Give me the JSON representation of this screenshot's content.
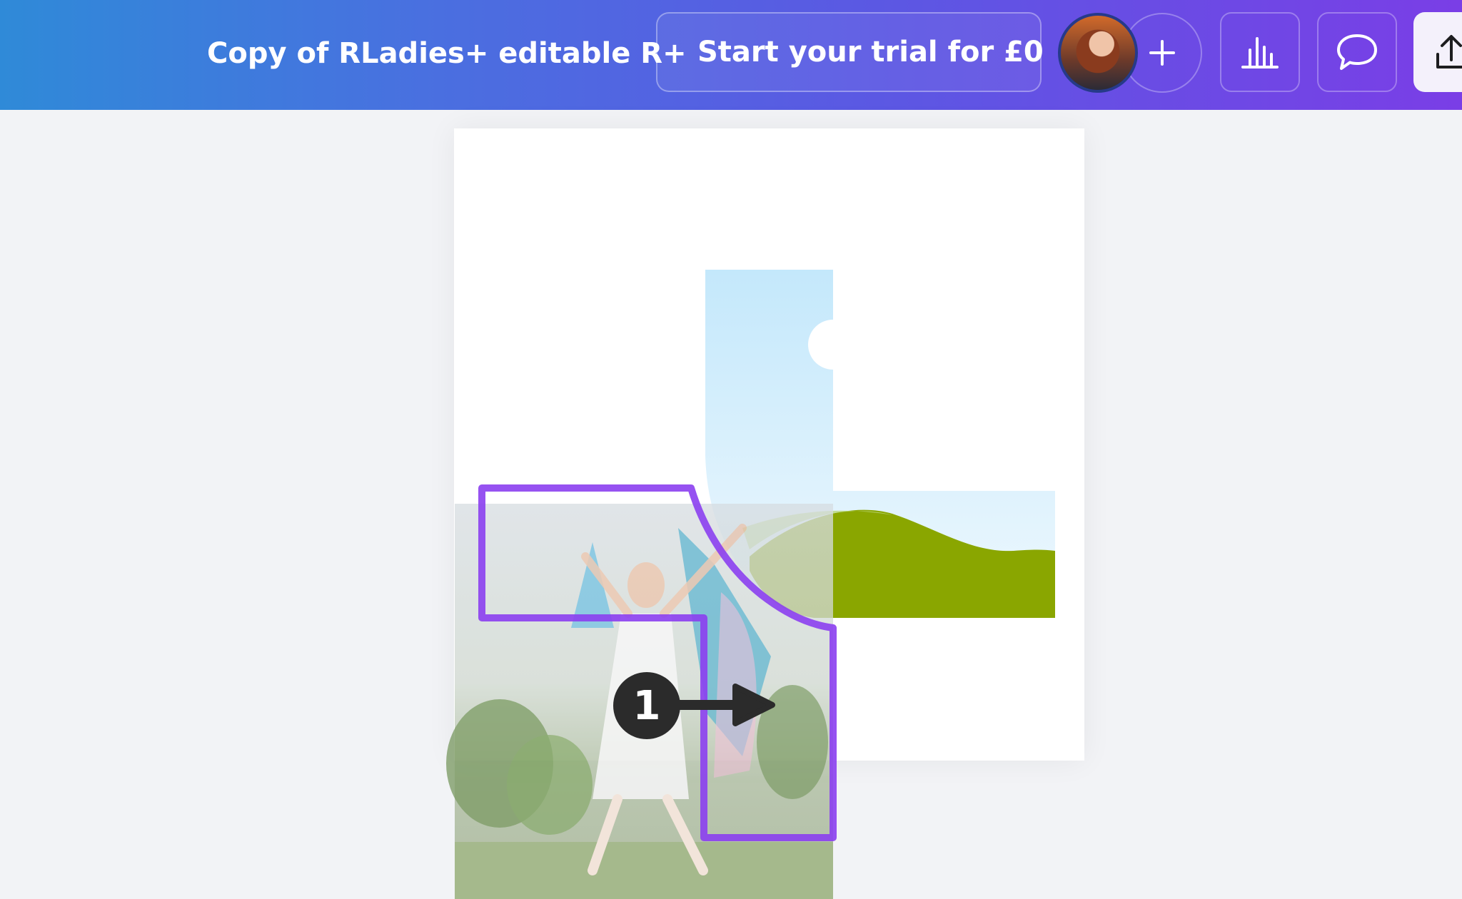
{
  "header": {
    "document_title": "Copy of RLadies+ editable R+",
    "trial_button_label": "Start your trial for £0",
    "crown_icon": "crown-icon",
    "add_icon": "plus-icon",
    "insights_icon": "bar-chart-icon",
    "comment_icon": "speech-bubble-icon",
    "share_icon": "share-upload-icon"
  },
  "canvas": {
    "step_number": "1",
    "arrow_icon": "arrow-right-icon"
  },
  "colors": {
    "selection_outline": "#8b3ff0",
    "green_wave": "#8aa600",
    "sky_blue": "#c4e8fb"
  }
}
